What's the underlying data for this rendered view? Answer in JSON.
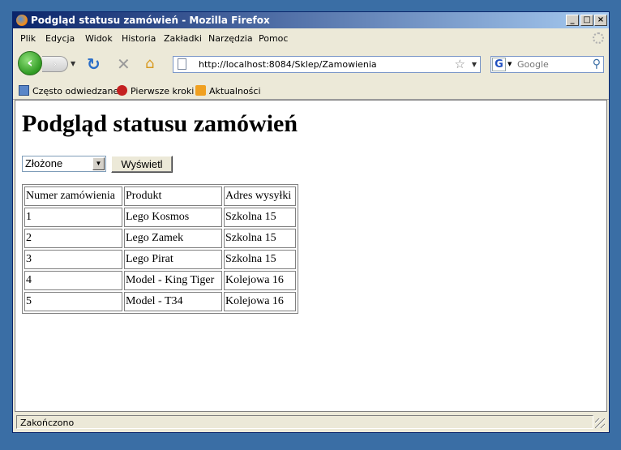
{
  "window": {
    "title": "Podgląd statusu zamówień - Mozilla Firefox"
  },
  "menu": [
    "Plik",
    "Edycja",
    "Widok",
    "Historia",
    "Zakładki",
    "Narzędzia",
    "Pomoc"
  ],
  "nav": {
    "url": "http://localhost:8084/Sklep/Zamowienia",
    "search_placeholder": "Google",
    "search_engine_icon": "G"
  },
  "bookmarks": [
    "Często odwiedzane",
    "Pierwsze kroki",
    "Aktualności"
  ],
  "page": {
    "heading": "Podgląd statusu zamówień",
    "status_select_value": "Złożone",
    "show_button": "Wyświetl",
    "table": {
      "headers": [
        "Numer zamówienia",
        "Produkt",
        "Adres wysyłki"
      ],
      "rows": [
        [
          "1",
          "Lego Kosmos",
          "Szkolna 15"
        ],
        [
          "2",
          "Lego Zamek",
          "Szkolna 15"
        ],
        [
          "3",
          "Lego Pirat",
          "Szkolna 15"
        ],
        [
          "4",
          "Model - King Tiger",
          "Kolejowa 16"
        ],
        [
          "5",
          "Model - T34",
          "Kolejowa 16"
        ]
      ]
    }
  },
  "status": {
    "text": "Zakończono"
  },
  "icons": {
    "back": "back-arrow-icon",
    "forward": "forward-arrow-icon",
    "reload": "reload-icon",
    "stop": "stop-icon",
    "home": "home-icon",
    "bookmark_star": "star-icon",
    "search": "magnifier-icon"
  },
  "colors": {
    "desktop": "#3a6ea5",
    "titlebar_start": "#0a246a",
    "chrome": "#ece9d8"
  }
}
